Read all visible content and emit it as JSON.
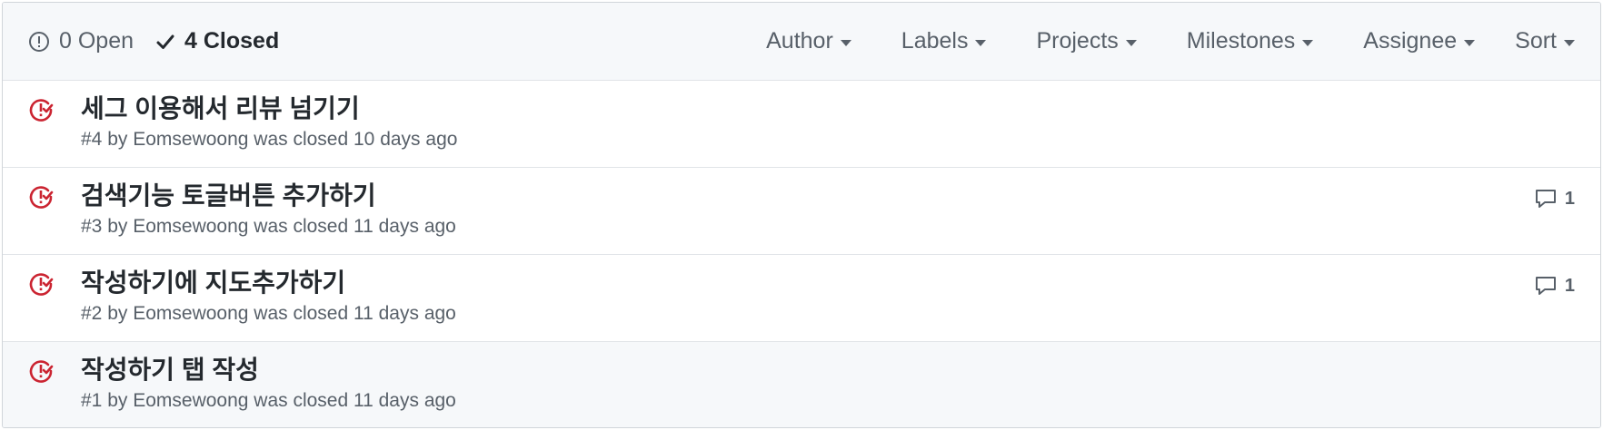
{
  "states": {
    "open_label": "0 Open",
    "closed_label": "4 Closed"
  },
  "filters": [
    {
      "label": "Author"
    },
    {
      "label": "Labels"
    },
    {
      "label": "Projects"
    },
    {
      "label": "Milestones"
    },
    {
      "label": "Assignee"
    },
    {
      "label": "Sort"
    }
  ],
  "issues": [
    {
      "title": "세그 이용해서 리뷰 넘기기",
      "meta": "#4 by Eomsewoong was closed 10 days ago",
      "comments": ""
    },
    {
      "title": "검색기능 토글버튼 추가하기",
      "meta": "#3 by Eomsewoong was closed 11 days ago",
      "comments": "1"
    },
    {
      "title": "작성하기에 지도추가하기",
      "meta": "#2 by Eomsewoong was closed 11 days ago",
      "comments": "1"
    },
    {
      "title": "작성하기 탭 작성",
      "meta": "#1 by Eomsewoong was closed 11 days ago",
      "comments": ""
    }
  ],
  "colors": {
    "closed_icon": "#cb2431",
    "muted": "#586069",
    "header_bg": "#f6f8fa"
  },
  "icons": {
    "open_state": "issue-opened-icon",
    "closed_state": "check-icon",
    "issue_closed": "issue-closed-icon",
    "comment": "comment-icon"
  }
}
